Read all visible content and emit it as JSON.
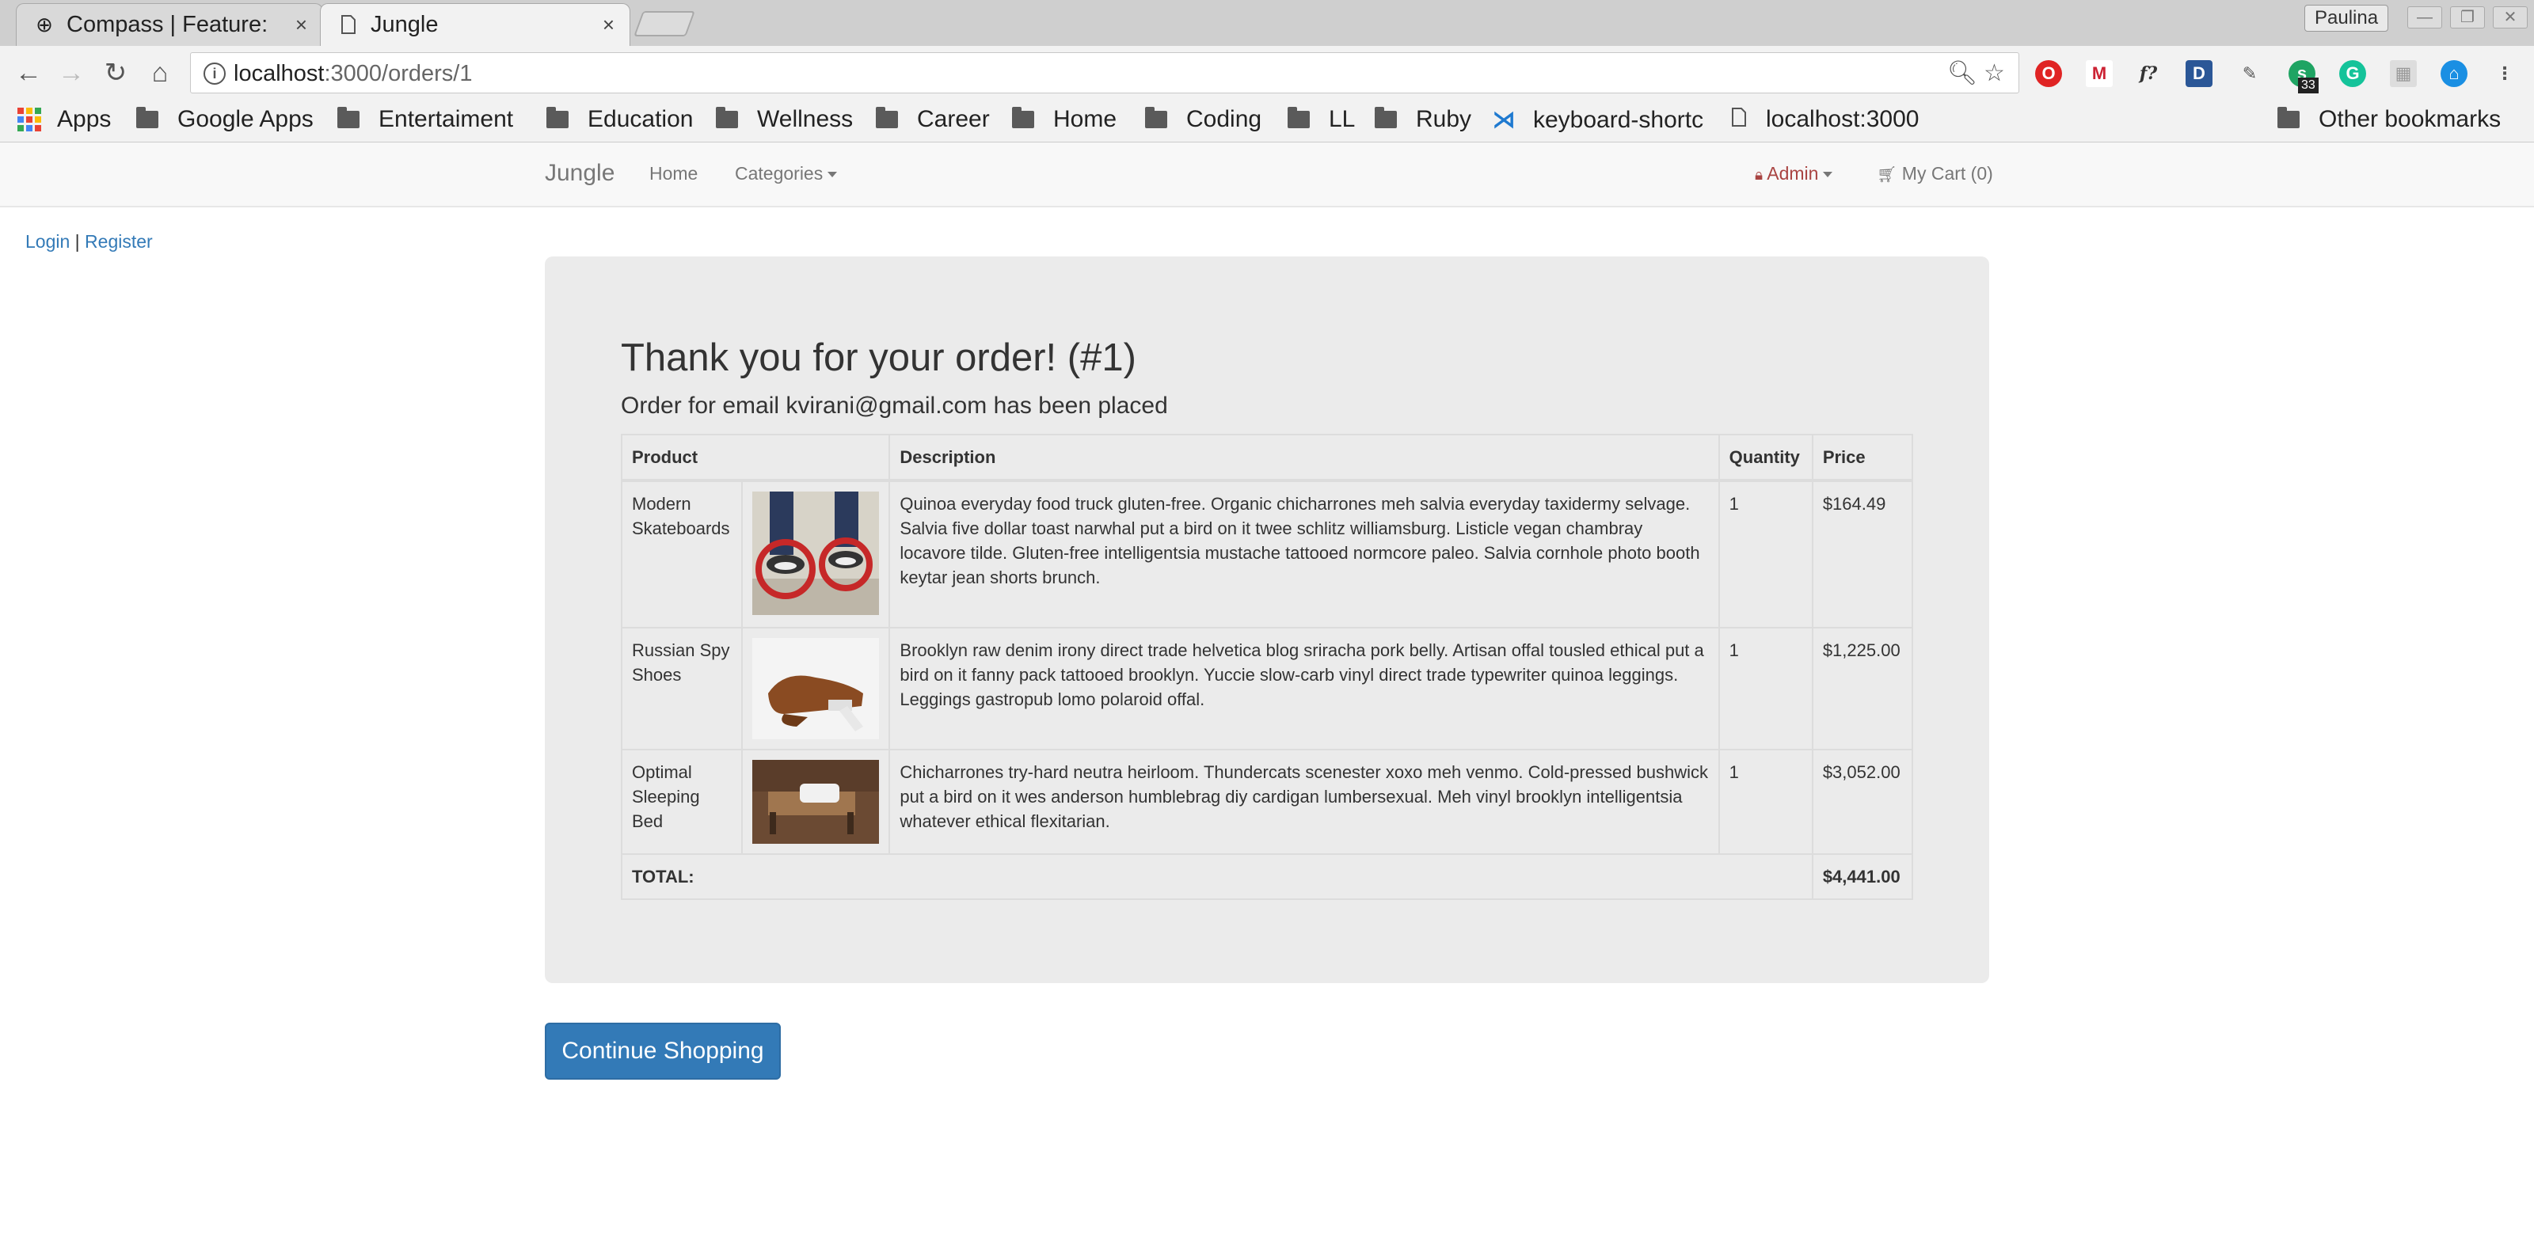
{
  "browser": {
    "tabs": [
      {
        "title": "Compass | Feature:",
        "icon": "compass-favicon"
      },
      {
        "title": "Jungle",
        "icon": "page-icon"
      }
    ],
    "profile_name": "Paulina",
    "url_host": "localhost",
    "url_rest": ":3000/orders/1",
    "extension_badge": "33",
    "bookmarks": {
      "apps": "Apps",
      "items": [
        "Google Apps",
        "Entertaiment",
        "Education",
        "Wellness",
        "Career",
        "Home",
        "Coding",
        "LL",
        "Ruby"
      ],
      "keyboard": "keyboard-shortc",
      "localhost": "localhost:3000",
      "other": "Other bookmarks"
    }
  },
  "navbar": {
    "brand": "Jungle",
    "home": "Home",
    "categories": "Categories",
    "admin": "Admin",
    "cart": "My Cart (0)"
  },
  "auth": {
    "login": "Login",
    "separator": "|",
    "register": "Register"
  },
  "order": {
    "title": "Thank you for your order! (#1)",
    "subtitle": "Order for email kvirani@gmail.com has been placed",
    "headers": {
      "product": "Product",
      "description": "Description",
      "quantity": "Quantity",
      "price": "Price"
    },
    "items": [
      {
        "name": "Modern Skateboards",
        "description": "Quinoa everyday food truck gluten-free. Organic chicharrones meh salvia everyday taxidermy selvage. Salvia five dollar toast narwhal put a bird on it twee schlitz williamsburg. Listicle vegan chambray locavore tilde. Gluten-free intelligentsia mustache tattooed normcore paleo. Salvia cornhole photo booth keytar jean shorts brunch.",
        "quantity": "1",
        "price": "$164.49"
      },
      {
        "name": "Russian Spy Shoes",
        "description": "Brooklyn raw denim irony direct trade helvetica blog sriracha pork belly. Artisan offal tousled ethical put a bird on it fanny pack tattooed brooklyn. Yuccie slow-carb vinyl direct trade typewriter quinoa leggings. Leggings gastropub lomo polaroid offal.",
        "quantity": "1",
        "price": "$1,225.00"
      },
      {
        "name": "Optimal Sleeping Bed",
        "description": "Chicharrones try-hard neutra heirloom. Thundercats scenester xoxo meh venmo. Cold-pressed bushwick put a bird on it wes anderson humblebrag diy cardigan lumbersexual. Meh vinyl brooklyn intelligentsia whatever ethical flexitarian.",
        "quantity": "1",
        "price": "$3,052.00"
      }
    ],
    "total_label": "TOTAL:",
    "total": "$4,441.00"
  },
  "continue_button": "Continue Shopping"
}
